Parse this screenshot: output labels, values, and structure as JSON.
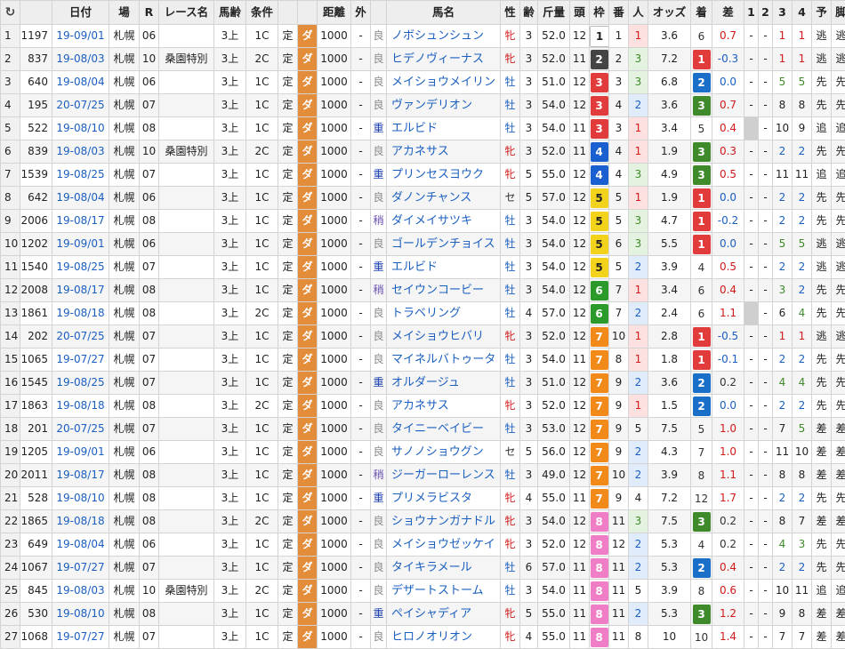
{
  "headers": {
    "refresh": "↻",
    "date": "日付",
    "place": "場",
    "race": "R",
    "racename": "レース名",
    "age": "馬齢",
    "cls": "条件",
    "dist": "距離",
    "out": "外",
    "horse": "馬名",
    "sex": "性",
    "old": "齢",
    "weight": "斤量",
    "count": "頭",
    "waku": "枠",
    "ban": "番",
    "pop": "人",
    "odds": "オッズ",
    "chaku": "着",
    "diff": "差",
    "c1": "1",
    "c2": "2",
    "c3": "3",
    "c4": "4",
    "pred": "予",
    "style": "脚"
  },
  "colors": {
    "waku1": "#ffffff",
    "waku2": "#444444",
    "waku3": "#e23b3b",
    "waku4": "#1a5fd0",
    "waku5": "#f2d21a",
    "waku6": "#2b9a2b",
    "waku7": "#f28a1a",
    "waku8": "#f07ec6",
    "chaku1": "#e23b3b",
    "chaku2": "#1a70c8",
    "chaku3": "#3f8a2a"
  },
  "rows": [
    {
      "i": "1",
      "id": "1197",
      "date": "19-09/01",
      "place": "札幌",
      "r": "06",
      "name": "",
      "age": "3上",
      "cls": "1C",
      "t": "定",
      "surf": "ダ",
      "dist": "1000",
      "out": "-",
      "ba": "良",
      "horse": "ノボシュンシュン",
      "sex": "牝",
      "old": "3",
      "wt": "52.0",
      "cnt": "12",
      "waku": "1",
      "ban": "1",
      "pop": "1",
      "odds": "3.6",
      "chaku": "6",
      "diff": "0.7",
      "c1": "-",
      "c2": "-",
      "c3": "1",
      "c4": "1",
      "pred": "逃",
      "style": "逃"
    },
    {
      "i": "2",
      "id": "837",
      "date": "19-08/03",
      "place": "札幌",
      "r": "10",
      "name": "桑園特別",
      "age": "3上",
      "cls": "2C",
      "t": "定",
      "surf": "ダ",
      "dist": "1000",
      "out": "-",
      "ba": "良",
      "horse": "ヒデノヴィーナス",
      "sex": "牝",
      "old": "3",
      "wt": "52.0",
      "cnt": "11",
      "waku": "2",
      "ban": "2",
      "pop": "3",
      "odds": "7.2",
      "chaku": "1",
      "diff": "-0.3",
      "c1": "-",
      "c2": "-",
      "c3": "1",
      "c4": "1",
      "pred": "逃",
      "style": "逃"
    },
    {
      "i": "3",
      "id": "640",
      "date": "19-08/04",
      "place": "札幌",
      "r": "06",
      "name": "",
      "age": "3上",
      "cls": "1C",
      "t": "定",
      "surf": "ダ",
      "dist": "1000",
      "out": "-",
      "ba": "良",
      "horse": "メイショウメイリン",
      "sex": "牡",
      "old": "3",
      "wt": "51.0",
      "cnt": "12",
      "waku": "3",
      "ban": "3",
      "pop": "3",
      "odds": "6.8",
      "chaku": "2",
      "diff": "0.0",
      "c1": "-",
      "c2": "-",
      "c3": "5",
      "c4": "5",
      "pred": "先",
      "style": "先"
    },
    {
      "i": "4",
      "id": "195",
      "date": "20-07/25",
      "place": "札幌",
      "r": "07",
      "name": "",
      "age": "3上",
      "cls": "1C",
      "t": "定",
      "surf": "ダ",
      "dist": "1000",
      "out": "-",
      "ba": "良",
      "horse": "ヴァンデリオン",
      "sex": "牡",
      "old": "3",
      "wt": "54.0",
      "cnt": "12",
      "waku": "3",
      "ban": "4",
      "pop": "2",
      "odds": "3.6",
      "chaku": "3",
      "diff": "0.7",
      "c1": "-",
      "c2": "-",
      "c3": "8",
      "c4": "8",
      "pred": "先",
      "style": "先"
    },
    {
      "i": "5",
      "id": "522",
      "date": "19-08/10",
      "place": "札幌",
      "r": "08",
      "name": "",
      "age": "3上",
      "cls": "1C",
      "t": "定",
      "surf": "ダ",
      "dist": "1000",
      "out": "-",
      "ba": "重",
      "horse": "エルビド",
      "sex": "牡",
      "old": "3",
      "wt": "54.0",
      "cnt": "11",
      "waku": "3",
      "ban": "3",
      "pop": "1",
      "odds": "3.4",
      "chaku": "5",
      "diff": "0.4",
      "c1": "",
      "c2": "-",
      "c3": "10",
      "c4": "9",
      "pred": "追",
      "style": "追"
    },
    {
      "i": "6",
      "id": "839",
      "date": "19-08/03",
      "place": "札幌",
      "r": "10",
      "name": "桑園特別",
      "age": "3上",
      "cls": "2C",
      "t": "定",
      "surf": "ダ",
      "dist": "1000",
      "out": "-",
      "ba": "良",
      "horse": "アカネサス",
      "sex": "牝",
      "old": "3",
      "wt": "52.0",
      "cnt": "11",
      "waku": "4",
      "ban": "4",
      "pop": "1",
      "odds": "1.9",
      "chaku": "3",
      "diff": "0.3",
      "c1": "-",
      "c2": "-",
      "c3": "2",
      "c4": "2",
      "pred": "先",
      "style": "先"
    },
    {
      "i": "7",
      "id": "1539",
      "date": "19-08/25",
      "place": "札幌",
      "r": "07",
      "name": "",
      "age": "3上",
      "cls": "1C",
      "t": "定",
      "surf": "ダ",
      "dist": "1000",
      "out": "-",
      "ba": "重",
      "horse": "プリンセスヨウク",
      "sex": "牝",
      "old": "5",
      "wt": "55.0",
      "cnt": "12",
      "waku": "4",
      "ban": "4",
      "pop": "3",
      "odds": "4.9",
      "chaku": "3",
      "diff": "0.5",
      "c1": "-",
      "c2": "-",
      "c3": "11",
      "c4": "11",
      "pred": "追",
      "style": "追"
    },
    {
      "i": "8",
      "id": "642",
      "date": "19-08/04",
      "place": "札幌",
      "r": "06",
      "name": "",
      "age": "3上",
      "cls": "1C",
      "t": "定",
      "surf": "ダ",
      "dist": "1000",
      "out": "-",
      "ba": "良",
      "horse": "ダノンチャンス",
      "sex": "セ",
      "old": "5",
      "wt": "57.0",
      "cnt": "12",
      "waku": "5",
      "ban": "5",
      "pop": "1",
      "odds": "1.9",
      "chaku": "1",
      "diff": "0.0",
      "c1": "-",
      "c2": "-",
      "c3": "2",
      "c4": "2",
      "pred": "先",
      "style": "先"
    },
    {
      "i": "9",
      "id": "2006",
      "date": "19-08/17",
      "place": "札幌",
      "r": "08",
      "name": "",
      "age": "3上",
      "cls": "1C",
      "t": "定",
      "surf": "ダ",
      "dist": "1000",
      "out": "-",
      "ba": "稍",
      "horse": "ダイメイサツキ",
      "sex": "牡",
      "old": "3",
      "wt": "54.0",
      "cnt": "12",
      "waku": "5",
      "ban": "5",
      "pop": "3",
      "odds": "4.7",
      "chaku": "1",
      "diff": "-0.2",
      "c1": "-",
      "c2": "-",
      "c3": "2",
      "c4": "2",
      "pred": "先",
      "style": "先"
    },
    {
      "i": "10",
      "id": "1202",
      "date": "19-09/01",
      "place": "札幌",
      "r": "06",
      "name": "",
      "age": "3上",
      "cls": "1C",
      "t": "定",
      "surf": "ダ",
      "dist": "1000",
      "out": "-",
      "ba": "良",
      "horse": "ゴールデンチョイス",
      "sex": "牡",
      "old": "3",
      "wt": "54.0",
      "cnt": "12",
      "waku": "5",
      "ban": "6",
      "pop": "3",
      "odds": "5.5",
      "chaku": "1",
      "diff": "0.0",
      "c1": "-",
      "c2": "-",
      "c3": "5",
      "c4": "5",
      "pred": "逃",
      "style": "逃"
    },
    {
      "i": "11",
      "id": "1540",
      "date": "19-08/25",
      "place": "札幌",
      "r": "07",
      "name": "",
      "age": "3上",
      "cls": "1C",
      "t": "定",
      "surf": "ダ",
      "dist": "1000",
      "out": "-",
      "ba": "重",
      "horse": "エルビド",
      "sex": "牡",
      "old": "3",
      "wt": "54.0",
      "cnt": "12",
      "waku": "5",
      "ban": "5",
      "pop": "2",
      "odds": "3.9",
      "chaku": "4",
      "diff": "0.5",
      "c1": "-",
      "c2": "-",
      "c3": "2",
      "c4": "2",
      "pred": "逃",
      "style": "逃"
    },
    {
      "i": "12",
      "id": "2008",
      "date": "19-08/17",
      "place": "札幌",
      "r": "08",
      "name": "",
      "age": "3上",
      "cls": "1C",
      "t": "定",
      "surf": "ダ",
      "dist": "1000",
      "out": "-",
      "ba": "稍",
      "horse": "セイウンコービー",
      "sex": "牡",
      "old": "3",
      "wt": "54.0",
      "cnt": "12",
      "waku": "6",
      "ban": "7",
      "pop": "1",
      "odds": "3.4",
      "chaku": "6",
      "diff": "0.4",
      "c1": "-",
      "c2": "-",
      "c3": "3",
      "c4": "2",
      "pred": "先",
      "style": "先"
    },
    {
      "i": "13",
      "id": "1861",
      "date": "19-08/18",
      "place": "札幌",
      "r": "08",
      "name": "",
      "age": "3上",
      "cls": "2C",
      "t": "定",
      "surf": "ダ",
      "dist": "1000",
      "out": "-",
      "ba": "良",
      "horse": "トラベリング",
      "sex": "牡",
      "old": "4",
      "wt": "57.0",
      "cnt": "12",
      "waku": "6",
      "ban": "7",
      "pop": "2",
      "odds": "2.4",
      "chaku": "6",
      "diff": "1.1",
      "c1": "",
      "c2": "-",
      "c3": "6",
      "c4": "4",
      "pred": "先",
      "style": "先"
    },
    {
      "i": "14",
      "id": "202",
      "date": "20-07/25",
      "place": "札幌",
      "r": "07",
      "name": "",
      "age": "3上",
      "cls": "1C",
      "t": "定",
      "surf": "ダ",
      "dist": "1000",
      "out": "-",
      "ba": "良",
      "horse": "メイショウヒバリ",
      "sex": "牝",
      "old": "3",
      "wt": "52.0",
      "cnt": "12",
      "waku": "7",
      "ban": "10",
      "pop": "1",
      "odds": "2.8",
      "chaku": "1",
      "diff": "-0.5",
      "c1": "-",
      "c2": "-",
      "c3": "1",
      "c4": "1",
      "pred": "逃",
      "style": "逃"
    },
    {
      "i": "15",
      "id": "1065",
      "date": "19-07/27",
      "place": "札幌",
      "r": "07",
      "name": "",
      "age": "3上",
      "cls": "1C",
      "t": "定",
      "surf": "ダ",
      "dist": "1000",
      "out": "-",
      "ba": "良",
      "horse": "マイネルバトゥータ",
      "sex": "牡",
      "old": "3",
      "wt": "54.0",
      "cnt": "11",
      "waku": "7",
      "ban": "8",
      "pop": "1",
      "odds": "1.8",
      "chaku": "1",
      "diff": "-0.1",
      "c1": "-",
      "c2": "-",
      "c3": "2",
      "c4": "2",
      "pred": "先",
      "style": "先"
    },
    {
      "i": "16",
      "id": "1545",
      "date": "19-08/25",
      "place": "札幌",
      "r": "07",
      "name": "",
      "age": "3上",
      "cls": "1C",
      "t": "定",
      "surf": "ダ",
      "dist": "1000",
      "out": "-",
      "ba": "重",
      "horse": "オルダージュ",
      "sex": "牡",
      "old": "3",
      "wt": "51.0",
      "cnt": "12",
      "waku": "7",
      "ban": "9",
      "pop": "2",
      "odds": "3.6",
      "chaku": "2",
      "diff": "0.2",
      "c1": "-",
      "c2": "-",
      "c3": "4",
      "c4": "4",
      "pred": "先",
      "style": "先"
    },
    {
      "i": "17",
      "id": "1863",
      "date": "19-08/18",
      "place": "札幌",
      "r": "08",
      "name": "",
      "age": "3上",
      "cls": "2C",
      "t": "定",
      "surf": "ダ",
      "dist": "1000",
      "out": "-",
      "ba": "良",
      "horse": "アカネサス",
      "sex": "牝",
      "old": "3",
      "wt": "52.0",
      "cnt": "12",
      "waku": "7",
      "ban": "9",
      "pop": "1",
      "odds": "1.5",
      "chaku": "2",
      "diff": "0.0",
      "c1": "-",
      "c2": "-",
      "c3": "2",
      "c4": "2",
      "pred": "先",
      "style": "先"
    },
    {
      "i": "18",
      "id": "201",
      "date": "20-07/25",
      "place": "札幌",
      "r": "07",
      "name": "",
      "age": "3上",
      "cls": "1C",
      "t": "定",
      "surf": "ダ",
      "dist": "1000",
      "out": "-",
      "ba": "良",
      "horse": "タイニーベイビー",
      "sex": "牡",
      "old": "3",
      "wt": "53.0",
      "cnt": "12",
      "waku": "7",
      "ban": "9",
      "pop": "5",
      "odds": "7.5",
      "chaku": "5",
      "diff": "1.0",
      "c1": "-",
      "c2": "-",
      "c3": "7",
      "c4": "5",
      "pred": "差",
      "style": "差"
    },
    {
      "i": "19",
      "id": "1205",
      "date": "19-09/01",
      "place": "札幌",
      "r": "06",
      "name": "",
      "age": "3上",
      "cls": "1C",
      "t": "定",
      "surf": "ダ",
      "dist": "1000",
      "out": "-",
      "ba": "良",
      "horse": "サノノショウグン",
      "sex": "セ",
      "old": "5",
      "wt": "56.0",
      "cnt": "12",
      "waku": "7",
      "ban": "9",
      "pop": "2",
      "odds": "4.3",
      "chaku": "7",
      "diff": "1.0",
      "c1": "-",
      "c2": "-",
      "c3": "11",
      "c4": "10",
      "pred": "差",
      "style": "差"
    },
    {
      "i": "20",
      "id": "2011",
      "date": "19-08/17",
      "place": "札幌",
      "r": "08",
      "name": "",
      "age": "3上",
      "cls": "1C",
      "t": "定",
      "surf": "ダ",
      "dist": "1000",
      "out": "-",
      "ba": "稍",
      "horse": "ジーガーローレンス",
      "sex": "牡",
      "old": "3",
      "wt": "49.0",
      "cnt": "12",
      "waku": "7",
      "ban": "10",
      "pop": "2",
      "odds": "3.9",
      "chaku": "8",
      "diff": "1.1",
      "c1": "-",
      "c2": "-",
      "c3": "8",
      "c4": "8",
      "pred": "差",
      "style": "差"
    },
    {
      "i": "21",
      "id": "528",
      "date": "19-08/10",
      "place": "札幌",
      "r": "08",
      "name": "",
      "age": "3上",
      "cls": "1C",
      "t": "定",
      "surf": "ダ",
      "dist": "1000",
      "out": "-",
      "ba": "重",
      "horse": "プリメラビスタ",
      "sex": "牝",
      "old": "4",
      "wt": "55.0",
      "cnt": "11",
      "waku": "7",
      "ban": "9",
      "pop": "4",
      "odds": "7.2",
      "chaku": "12",
      "diff": "1.7",
      "c1": "-",
      "c2": "-",
      "c3": "2",
      "c4": "2",
      "pred": "先",
      "style": "先"
    },
    {
      "i": "22",
      "id": "1865",
      "date": "19-08/18",
      "place": "札幌",
      "r": "08",
      "name": "",
      "age": "3上",
      "cls": "2C",
      "t": "定",
      "surf": "ダ",
      "dist": "1000",
      "out": "-",
      "ba": "良",
      "horse": "ショウナンガナドル",
      "sex": "牝",
      "old": "3",
      "wt": "54.0",
      "cnt": "12",
      "waku": "8",
      "ban": "11",
      "pop": "3",
      "odds": "7.5",
      "chaku": "3",
      "diff": "0.2",
      "c1": "-",
      "c2": "-",
      "c3": "8",
      "c4": "7",
      "pred": "差",
      "style": "差"
    },
    {
      "i": "23",
      "id": "649",
      "date": "19-08/04",
      "place": "札幌",
      "r": "06",
      "name": "",
      "age": "3上",
      "cls": "1C",
      "t": "定",
      "surf": "ダ",
      "dist": "1000",
      "out": "-",
      "ba": "良",
      "horse": "メイショウゼッケイ",
      "sex": "牝",
      "old": "3",
      "wt": "52.0",
      "cnt": "12",
      "waku": "8",
      "ban": "12",
      "pop": "2",
      "odds": "5.3",
      "chaku": "4",
      "diff": "0.2",
      "c1": "-",
      "c2": "-",
      "c3": "4",
      "c4": "3",
      "pred": "先",
      "style": "先"
    },
    {
      "i": "24",
      "id": "1067",
      "date": "19-07/27",
      "place": "札幌",
      "r": "07",
      "name": "",
      "age": "3上",
      "cls": "1C",
      "t": "定",
      "surf": "ダ",
      "dist": "1000",
      "out": "-",
      "ba": "良",
      "horse": "タイキラメール",
      "sex": "牡",
      "old": "6",
      "wt": "57.0",
      "cnt": "11",
      "waku": "8",
      "ban": "11",
      "pop": "2",
      "odds": "5.3",
      "chaku": "2",
      "diff": "0.4",
      "c1": "-",
      "c2": "-",
      "c3": "2",
      "c4": "2",
      "pred": "先",
      "style": "先"
    },
    {
      "i": "25",
      "id": "845",
      "date": "19-08/03",
      "place": "札幌",
      "r": "10",
      "name": "桑園特別",
      "age": "3上",
      "cls": "2C",
      "t": "定",
      "surf": "ダ",
      "dist": "1000",
      "out": "-",
      "ba": "良",
      "horse": "デザートストーム",
      "sex": "牡",
      "old": "3",
      "wt": "54.0",
      "cnt": "11",
      "waku": "8",
      "ban": "11",
      "pop": "5",
      "odds": "3.9",
      "chaku": "8",
      "diff": "0.6",
      "c1": "-",
      "c2": "-",
      "c3": "10",
      "c4": "11",
      "pred": "追",
      "style": "追"
    },
    {
      "i": "26",
      "id": "530",
      "date": "19-08/10",
      "place": "札幌",
      "r": "08",
      "name": "",
      "age": "3上",
      "cls": "1C",
      "t": "定",
      "surf": "ダ",
      "dist": "1000",
      "out": "-",
      "ba": "重",
      "horse": "ペイシャディア",
      "sex": "牝",
      "old": "5",
      "wt": "55.0",
      "cnt": "11",
      "waku": "8",
      "ban": "11",
      "pop": "2",
      "odds": "5.3",
      "chaku": "3",
      "diff": "1.2",
      "c1": "-",
      "c2": "-",
      "c3": "9",
      "c4": "8",
      "pred": "差",
      "style": "差"
    },
    {
      "i": "27",
      "id": "1068",
      "date": "19-07/27",
      "place": "札幌",
      "r": "07",
      "name": "",
      "age": "3上",
      "cls": "1C",
      "t": "定",
      "surf": "ダ",
      "dist": "1000",
      "out": "-",
      "ba": "良",
      "horse": "ヒロノオリオン",
      "sex": "牝",
      "old": "4",
      "wt": "55.0",
      "cnt": "11",
      "waku": "8",
      "ban": "11",
      "pop": "8",
      "odds": "10",
      "chaku": "10",
      "diff": "1.4",
      "c1": "-",
      "c2": "-",
      "c3": "7",
      "c4": "7",
      "pred": "差",
      "style": "差"
    }
  ]
}
